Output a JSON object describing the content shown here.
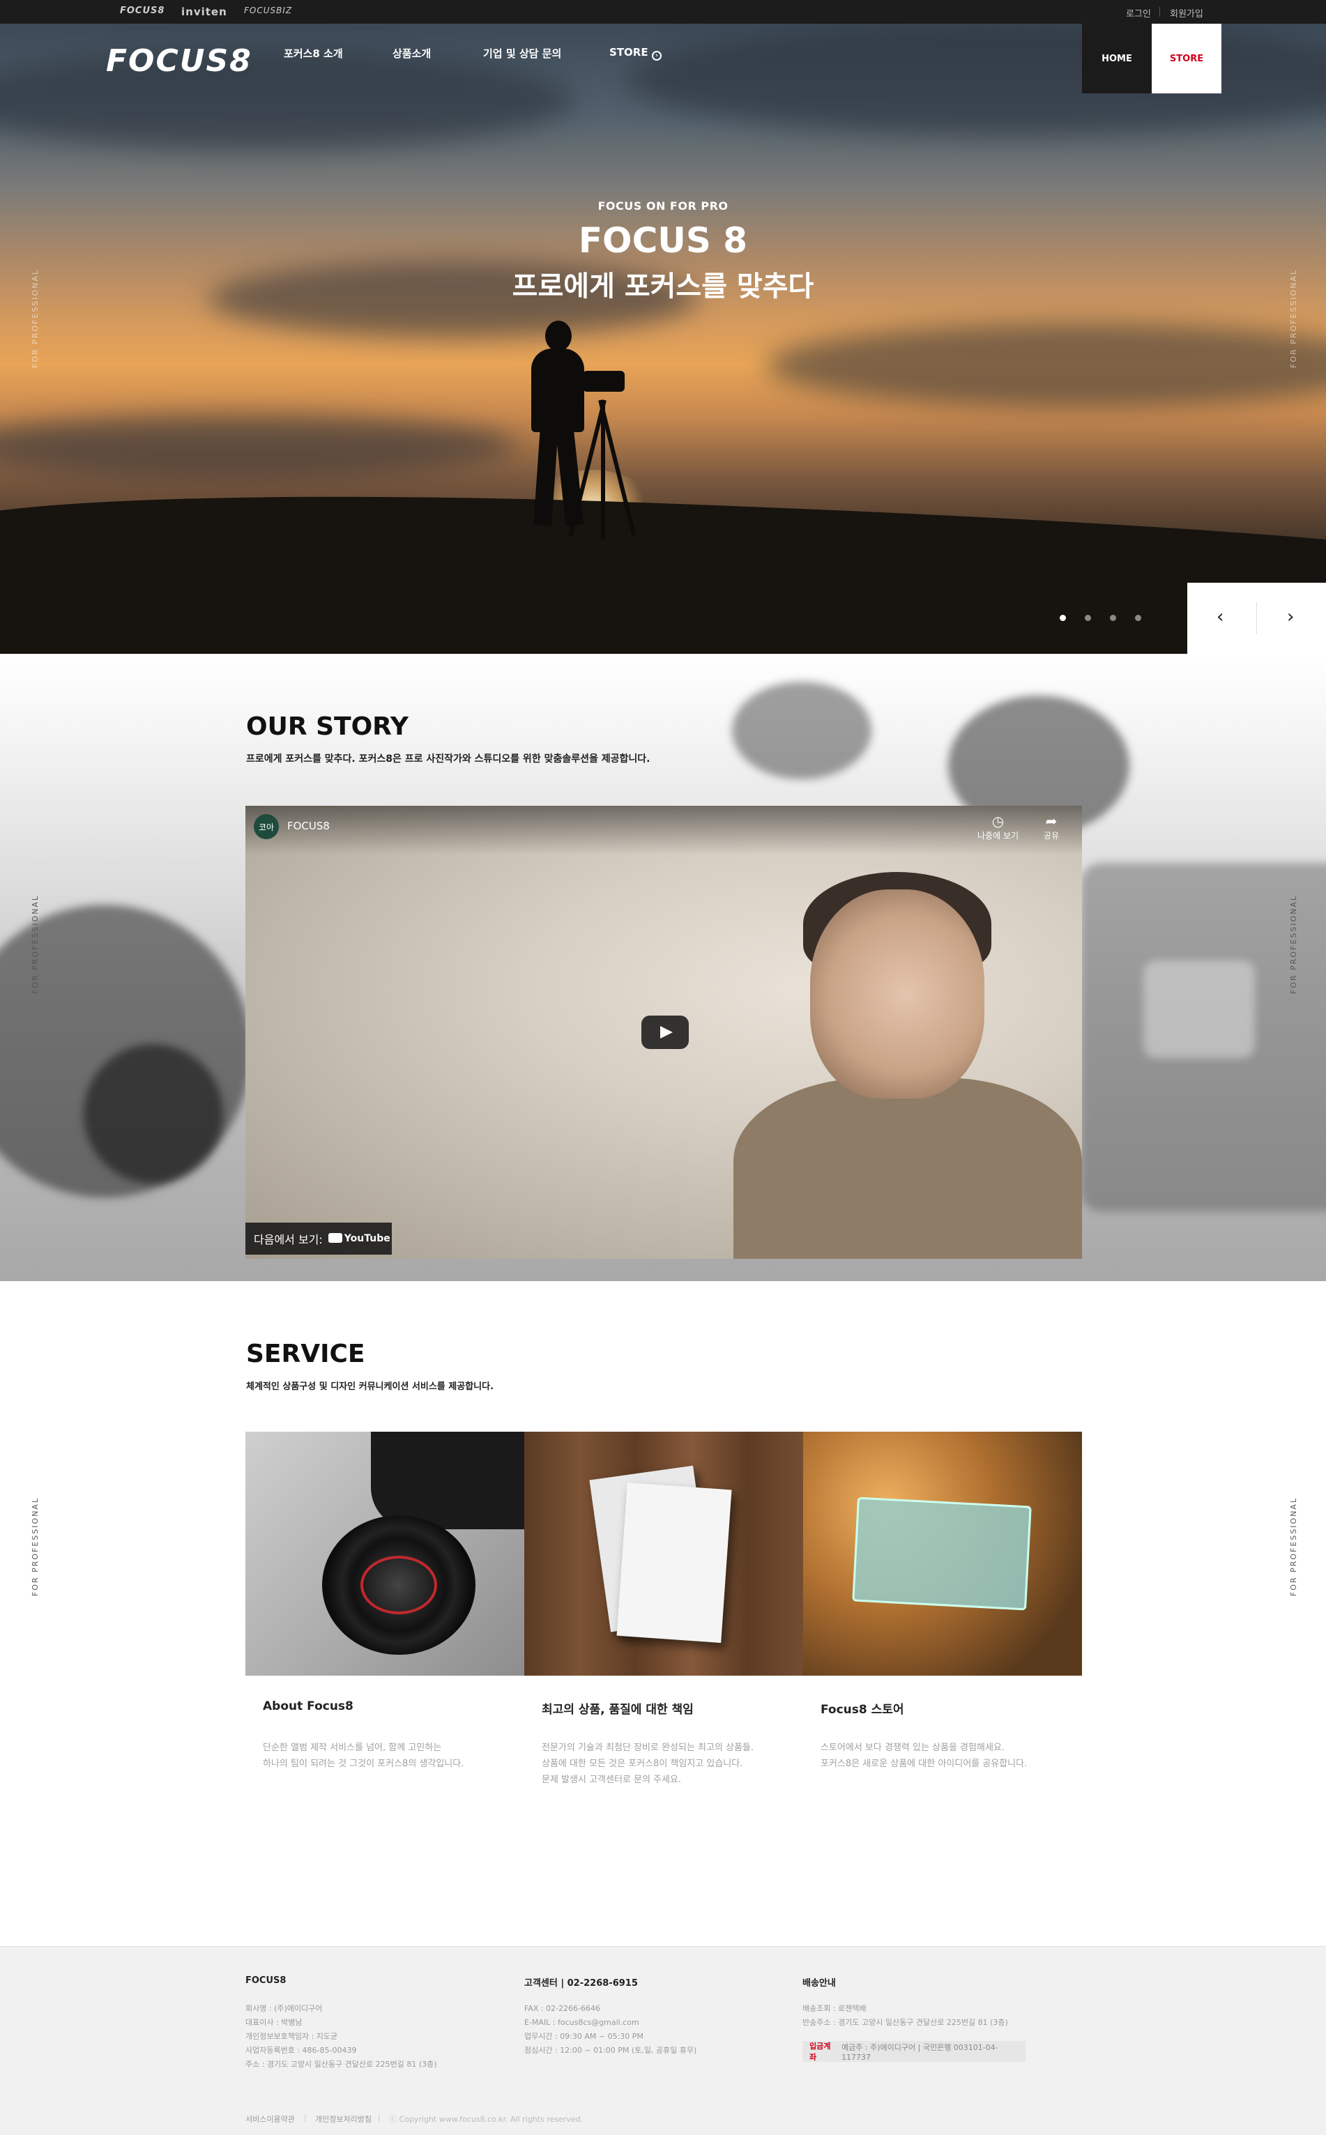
{
  "topbar": {
    "brands": [
      "FOCUS8",
      "inviten",
      "FOCUSBIZ"
    ],
    "login": "로그인",
    "join": "회원가입"
  },
  "header": {
    "logo": "FOCUS8",
    "nav": [
      "포커스8 소개",
      "상품소개",
      "기업 및 상담 문의",
      "STORE"
    ],
    "home_button": "HOME",
    "store_button": "STORE"
  },
  "hero": {
    "kicker": "FOCUS ON FOR PRO",
    "title": "FOCUS 8",
    "subtitle": "프로에게 포커스를 맞추다",
    "side_text": "FOR PROFESSIONAL",
    "slides": 4,
    "active_slide": 1,
    "prev": "‹",
    "next": "›"
  },
  "story": {
    "title": "OUR STORY",
    "subtitle": "프로에게 포커스를 맞추다. 포커스8은 프로 사진작가와 스튜디오를 위한 맞춤솔루션을 제공합니다.",
    "side_text": "FOR PROFESSIONAL",
    "video": {
      "avatar": "코아",
      "channel": "FOCUS8",
      "watch_later": "나중에 보기",
      "share": "공유",
      "watch_on": "다음에서 보기:",
      "youtube": "YouTube"
    }
  },
  "service": {
    "title": "SERVICE",
    "subtitle": "체계적인 상품구성 및 디자인 커뮤니케이션 서비스를 제공합니다.",
    "side_text": "FOR PROFESSIONAL",
    "cards": [
      {
        "title": "About Focus8",
        "desc": "단순한 앨범 제작 서비스를 넘어, 함께 고민하는\n하나의 팀이 되려는 것 그것이 포커스8의 생각입니다."
      },
      {
        "title": "최고의 상품, 품질에 대한 책임",
        "desc": "전문가의 기술과 최첨단 장비로 완성되는 최고의 상품들.\n상품에 대한 모든 것은 포커스8이 책임지고 있습니다.\n문제 발생시 고객센터로 문의 주세요."
      },
      {
        "title": "Focus8 스토어",
        "desc": "스토어에서 보다 경쟁력 있는 상품을 경험해세요.\n포커스8은 새로운 상품에 대한 아이디어를 공유합니다."
      }
    ]
  },
  "footer": {
    "col1": {
      "head": "FOCUS8",
      "lines": [
        "회사명 : (주)에이디구어",
        "대표이사 : 박병남",
        "개인정보보호책임자 : 지도균",
        "사업자등록번호 : 486-85-00439",
        "주소 : 경기도 고양시 일산동구 견달산로 225번길 81 (3층)"
      ]
    },
    "col2": {
      "head": "고객센터  |  02-2268-6915",
      "lines": [
        "FAX : 02-2266-6646",
        "E-MAIL : focus8cs@gmail.com",
        "업무시간 : 09:30 AM ~ 05:30 PM",
        "점심시간 : 12:00 ~ 01:00 PM (토,일, 공휴일 휴무)"
      ]
    },
    "col3": {
      "head": "배송안내",
      "lines": [
        "배송조회 : 로젠택배",
        "반송주소 : 경기도 고양시 일산동구 견달산로 225번길 81 (3층)"
      ],
      "bank_label": "입금계좌",
      "bank_text": "예금주 : 주)에이디구어  |  국민은행 003101-04-117737"
    },
    "bottom": [
      "서비스이용약관",
      "개인정보처리방침",
      "ⓒ Copyright www.focus8.co.kr. All rights reserved."
    ]
  }
}
